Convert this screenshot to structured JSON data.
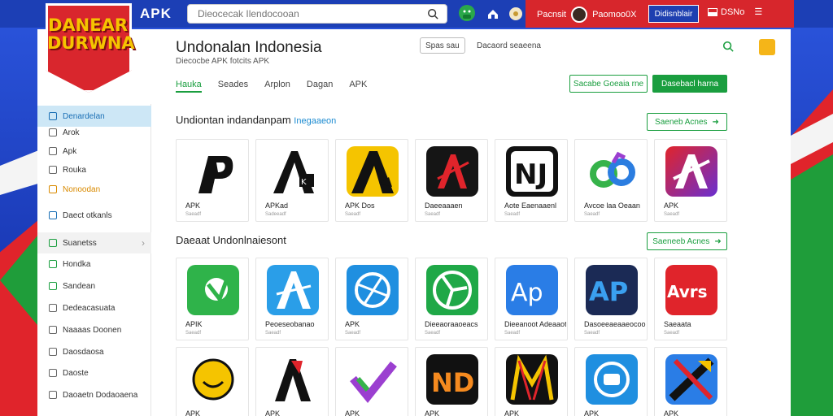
{
  "logo": {
    "text": "DANEAR DURWNA"
  },
  "topbar": {
    "apk_label": "APK",
    "search_placeholder": "Dieocecak Ilendocooan",
    "user_name": "Pacnsit",
    "user_label": "Paomoo0X",
    "button_label": "Didisnblair",
    "lang_label": "DSNo"
  },
  "header": {
    "title": "Undonalan Indonesia",
    "subtitle": "Diecocbe APK fotcits APK",
    "btn1": "Spas sau",
    "btn2": "Dacaord seaeena"
  },
  "tabs": [
    "Hauka",
    "Seades",
    "Arplon",
    "Dagan",
    "APK"
  ],
  "actions": {
    "outline": "Sacabe Goeaia rne",
    "solid": "Dasebacl harna"
  },
  "sidebar": {
    "items": [
      {
        "label": "Denardelan"
      },
      {
        "label": "Arok"
      },
      {
        "label": "Apk"
      },
      {
        "label": "Rouka"
      },
      {
        "label": "Nonoodan"
      },
      {
        "label": "Daect otkanls"
      },
      {
        "label": "Suanetss"
      },
      {
        "label": "Hondka"
      },
      {
        "label": "Sandean"
      },
      {
        "label": "Dedeacasuata"
      },
      {
        "label": "Naaaas Doonen"
      },
      {
        "label": "Daosdaosa"
      },
      {
        "label": "Daoste"
      },
      {
        "label": "Daoaetn Dodaoaena"
      }
    ]
  },
  "section1": {
    "title": "Undiontan indandanpam",
    "accent": "Inegaaeon",
    "more": "Saeneb Acnes",
    "apps": [
      {
        "name": "APK",
        "meta": "Saeadf"
      },
      {
        "name": "APKad",
        "meta": "Sadeeadf"
      },
      {
        "name": "APK Dos",
        "meta": "Saeadf"
      },
      {
        "name": "Daeeaaaen",
        "meta": "Saeadf"
      },
      {
        "name": "Aote Eaenaaenl",
        "meta": "Saeadf"
      },
      {
        "name": "Avcoe laa Oeaan",
        "meta": "Saeadf"
      },
      {
        "name": "APK",
        "meta": "Saeadf"
      }
    ]
  },
  "section2": {
    "title": "Daeaat Undonlnaiesont",
    "more": "Saeneeb Acnes",
    "apps": [
      {
        "name": "APIK",
        "meta": "Saeadf"
      },
      {
        "name": "Peoeseobanao",
        "meta": "Saeadf"
      },
      {
        "name": "APK",
        "meta": "Saeadf"
      },
      {
        "name": "Dieeaoraaoeacs",
        "meta": "Saeadf"
      },
      {
        "name": "Dieeanoot Adeaaot",
        "meta": "Saeadf"
      },
      {
        "name": "Dasoeeaeaaeocoo",
        "meta": "Saeadf"
      },
      {
        "name": "Saeaata",
        "meta": "Saeadf"
      }
    ]
  },
  "row3": {
    "apps": [
      {
        "name": "APK"
      },
      {
        "name": "APK"
      },
      {
        "name": "APK"
      },
      {
        "name": "APK"
      },
      {
        "name": "APK"
      },
      {
        "name": "APK"
      },
      {
        "name": "APK"
      }
    ]
  }
}
